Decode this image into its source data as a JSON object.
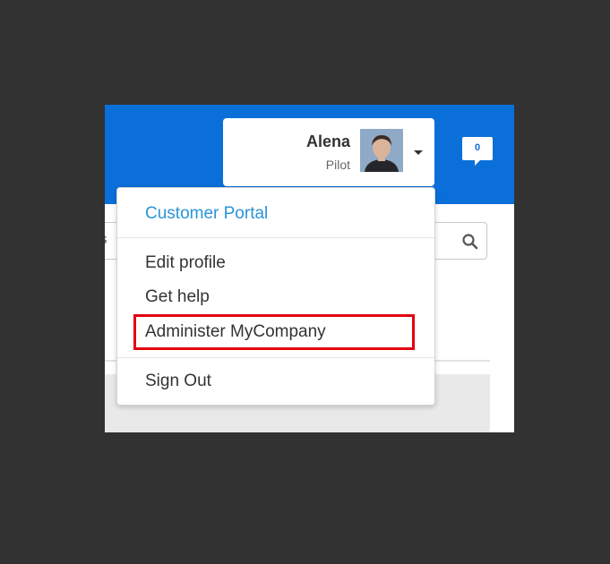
{
  "header": {
    "user_name": "Alena",
    "user_role": "Pilot",
    "notification_count": "0",
    "brand_color": "#0b6fd9"
  },
  "background": {
    "search_partial_text": "ls"
  },
  "menu": {
    "customer_portal": "Customer Portal",
    "edit_profile": "Edit profile",
    "get_help": "Get help",
    "administer": "Administer MyCompany",
    "sign_out": "Sign Out",
    "highlight_color": "#e2000f"
  },
  "icons": {
    "search": "search-icon",
    "caret": "caret-down-icon",
    "notifications": "chat-bubble-icon",
    "avatar": "avatar"
  }
}
